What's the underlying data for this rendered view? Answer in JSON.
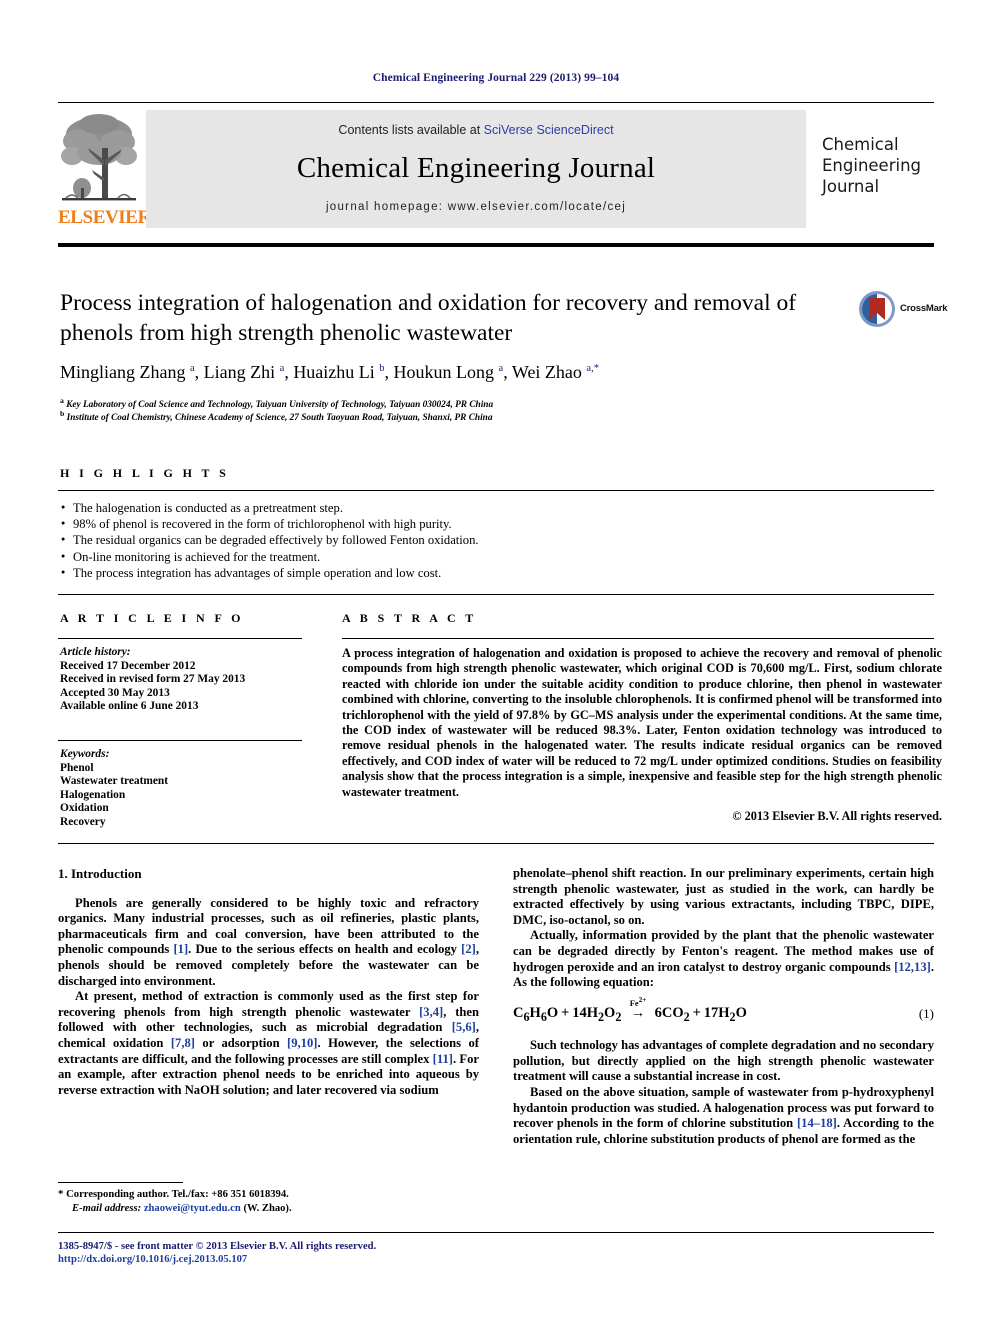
{
  "running_head": "Chemical Engineering Journal 229 (2013) 99–104",
  "masthead": {
    "contents_prefix": "Contents lists available at ",
    "sciencedirect": "SciVerse ScienceDirect",
    "journal_name": "Chemical Engineering Journal",
    "homepage": "journal homepage: www.elsevier.com/locate/cej",
    "publisher_wordmark": "ELSEVIER",
    "cover_title_line1": "Chemical",
    "cover_title_line2": "Engineering",
    "cover_title_line3": "Journal",
    "elsevier_orange": "#f07c1a"
  },
  "article": {
    "title": "Process integration of halogenation and oxidation for recovery and removal of phenols from high strength phenolic wastewater",
    "authors_html": "Mingliang Zhang <sup>a</sup>, Liang Zhi <sup>a</sup>, Huaizhu Li <sup>b</sup>, Houkun Long <sup>a</sup>, Wei Zhao <sup>a,*</sup>",
    "affiliation_a": "Key Laboratory of Coal Science and Technology, Taiyuan University of Technology, Taiyuan 030024, PR China",
    "affiliation_b": "Institute of Coal Chemistry, Chinese Academy of Science, 27 South Taoyuan Road, Taiyuan, Shanxi, PR China",
    "crossmark_label": "CrossMark"
  },
  "highlights": {
    "heading": "H I G H L I G H T S",
    "items": [
      "The halogenation is conducted as a pretreatment step.",
      "98% of phenol is recovered in the form of trichlorophenol with high purity.",
      "The residual organics can be degraded effectively by followed Fenton oxidation.",
      "On-line monitoring is achieved for the treatment.",
      "The process integration has advantages of simple operation and low cost."
    ]
  },
  "article_info": {
    "heading": "A R T I C L E    I N F O",
    "history_label": "Article history:",
    "history": [
      "Received 17 December 2012",
      "Received in revised form 27 May 2013",
      "Accepted 30 May 2013",
      "Available online 6 June 2013"
    ],
    "keywords_label": "Keywords:",
    "keywords": [
      "Phenol",
      "Wastewater treatment",
      "Halogenation",
      "Oxidation",
      "Recovery"
    ]
  },
  "abstract": {
    "heading": "A B S T R A C T",
    "text": "A process integration of halogenation and oxidation is proposed to achieve the recovery and removal of phenolic compounds from high strength phenolic wastewater, which original COD is 70,600 mg/L. First, sodium chlorate reacted with chloride ion under the suitable acidity condition to produce chlorine, then phenol in wastewater combined with chlorine, converting to the insoluble chlorophenols. It is confirmed phenol will be transformed into trichlorophenol with the yield of 97.8% by GC–MS analysis under the experimental conditions. At the same time, the COD index of wastewater will be reduced 98.3%. Later, Fenton oxidation technology was introduced to remove residual phenols in the halogenated water. The results indicate residual organics can be removed effectively, and COD index of water will be reduced to 72 mg/L under optimized conditions. Studies on feasibility analysis show that the process integration is a simple, inexpensive and feasible step for the high strength phenolic wastewater treatment.",
    "copyright": "© 2013 Elsevier B.V. All rights reserved."
  },
  "body": {
    "section_heading": "1. Introduction",
    "left_p1": "Phenols are generally considered to be highly toxic and refractory organics. Many industrial processes, such as oil refineries, plastic plants, pharmaceuticals firm and coal conversion, have been attributed to the phenolic compounds [1]. Due to the serious effects on health and ecology [2], phenols should be removed completely before the wastewater can be discharged into environment.",
    "left_p2": "At present, method of extraction is commonly used as the first step for recovering phenols from high strength phenolic wastewater [3,4], then followed with other technologies, such as microbial degradation [5,6], chemical oxidation [7,8] or adsorption [9,10]. However, the selections of extractants are difficult, and the following processes are still complex [11]. For an example, after extraction phenol needs to be enriched into aqueous by reverse extraction with NaOH solution; and later recovered via sodium",
    "right_p1": "phenolate–phenol shift reaction. In our preliminary experiments, certain high strength phenolic wastewater, just as studied in the work, can hardly be extracted effectively by using various extractants, including TBPC, DIPE, DMC, iso-octanol, so on.",
    "right_p2": "Actually, information provided by the plant that the phenolic wastewater can be degraded directly by Fenton's reagent. The method makes use of hydrogen peroxide and an iron catalyst to destroy organic compounds [12,13]. As the following equation:",
    "equation": {
      "left": "C6H6O + 14H2O2",
      "catalyst": "Fe2+",
      "right": "6CO2 + 17H2O",
      "number": "(1)"
    },
    "right_p3": "Such technology has advantages of complete degradation and no secondary pollution, but directly applied on the high strength phenolic wastewater treatment will cause a substantial increase in cost.",
    "right_p4": "Based on the above situation, sample of wastewater from p-hydroxyphenyl hydantoin production was studied. A halogenation process was put forward to recover phenols in the form of chlorine substitution [14–18]. According to the orientation rule, chlorine substitution products of phenol are formed as the"
  },
  "footnote": {
    "corresponding": "Corresponding author. Tel./fax: +86 351 6018394.",
    "email_label": "E-mail address:",
    "email": "zhaowei@tyut.edu.cn",
    "email_suffix": "(W. Zhao)."
  },
  "imprint": {
    "line1": "1385-8947/$ - see front matter © 2013 Elsevier B.V. All rights reserved.",
    "doi": "http://dx.doi.org/10.1016/j.cej.2013.05.107"
  }
}
